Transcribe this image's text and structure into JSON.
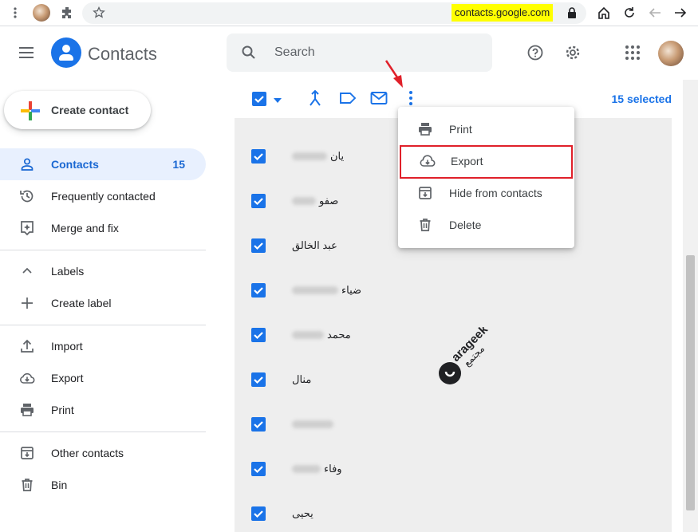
{
  "browser": {
    "url": "contacts.google.com"
  },
  "header": {
    "app_title": "Contacts",
    "search_placeholder": "Search"
  },
  "sidebar": {
    "create_label": "Create contact",
    "items": [
      {
        "label": "Contacts",
        "count": "15",
        "icon": "person-icon"
      },
      {
        "label": "Frequently contacted",
        "icon": "history-icon"
      },
      {
        "label": "Merge and fix",
        "icon": "merge-fix-icon"
      },
      {
        "label": "Labels",
        "icon": "chevron-up-icon"
      },
      {
        "label": "Create label",
        "icon": "plus-icon"
      },
      {
        "label": "Import",
        "icon": "upload-icon"
      },
      {
        "label": "Export",
        "icon": "cloud-download-icon"
      },
      {
        "label": "Print",
        "icon": "printer-icon"
      },
      {
        "label": "Other contacts",
        "icon": "archive-icon"
      },
      {
        "label": "Bin",
        "icon": "trash-icon"
      }
    ]
  },
  "toolbar": {
    "selected_text": "15 selected"
  },
  "menu": {
    "items": [
      {
        "label": "Print",
        "icon": "printer-icon"
      },
      {
        "label": "Export",
        "icon": "cloud-download-icon"
      },
      {
        "label": "Hide from contacts",
        "icon": "archive-icon"
      },
      {
        "label": "Delete",
        "icon": "trash-icon"
      }
    ]
  },
  "contacts": [
    {
      "name": "يان"
    },
    {
      "name": "صفو"
    },
    {
      "name": "عبد الخالق"
    },
    {
      "name": "ضياء"
    },
    {
      "name": "محمد"
    },
    {
      "name": "منال"
    },
    {
      "name": ""
    },
    {
      "name": "وفاء"
    },
    {
      "name": "يحيى"
    }
  ],
  "watermark": {
    "text_latin": "arageek",
    "text_arabic": "مجتمع"
  },
  "colors": {
    "accent": "#1a73e8",
    "highlight": "#e0202a",
    "url_highlight": "#ffff00"
  }
}
